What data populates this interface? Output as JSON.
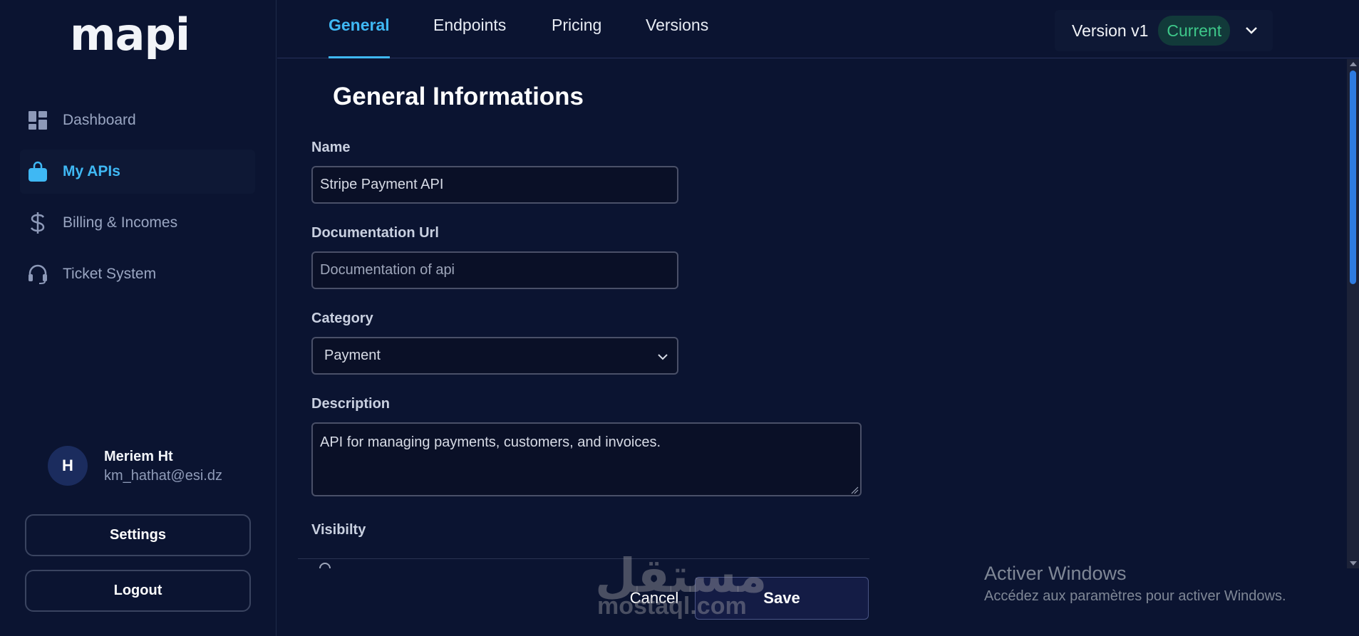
{
  "app": {
    "logo": "mapi"
  },
  "sidebar": {
    "items": [
      {
        "label": "Dashboard",
        "icon": "dashboard-icon",
        "active": false
      },
      {
        "label": "My APIs",
        "icon": "shopping-bag-icon",
        "active": true
      },
      {
        "label": "Billing & Incomes",
        "icon": "dollar-icon",
        "active": false
      },
      {
        "label": "Ticket System",
        "icon": "headset-icon",
        "active": false
      }
    ],
    "user": {
      "initial": "H",
      "name": "Meriem Ht",
      "email": "km_hathat@esi.dz"
    },
    "settings_label": "Settings",
    "logout_label": "Logout"
  },
  "tabs": [
    {
      "label": "General",
      "active": true
    },
    {
      "label": "Endpoints",
      "active": false
    },
    {
      "label": "Pricing",
      "active": false
    },
    {
      "label": "Versions",
      "active": false
    }
  ],
  "version": {
    "label": "Version v1",
    "badge": "Current"
  },
  "form": {
    "title": "General Informations",
    "name_label": "Name",
    "name_value": "Stripe Payment API",
    "doc_label": "Documentation Url",
    "doc_placeholder": "Documentation of api",
    "category_label": "Category",
    "category_value": "Payment",
    "description_label": "Description",
    "description_value": "API for managing payments, customers, and invoices.",
    "visibility_label": "Visibilty"
  },
  "actions": {
    "cancel_label": "Cancel",
    "save_label": "Save"
  },
  "watermark": {
    "arabic": "مستقل",
    "latin": "mostaql.com"
  },
  "windows_activation": {
    "title": "Activer Windows",
    "subtitle": "Accédez aux paramètres pour activer Windows."
  },
  "colors": {
    "background": "#0b1431",
    "accent": "#3fb8f4",
    "badge_green": "#3ec98a",
    "scroll_thumb": "#2e7be0"
  }
}
